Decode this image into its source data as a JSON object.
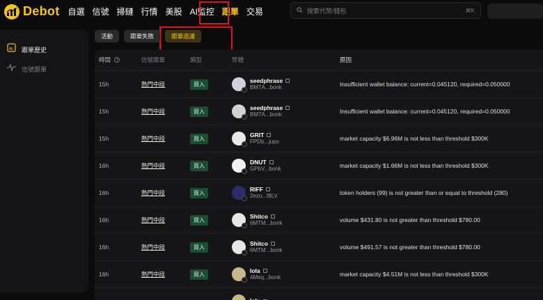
{
  "brand": {
    "name": "Debot",
    "color": "#f5c518"
  },
  "nav": {
    "items": [
      {
        "label": "自選"
      },
      {
        "label": "信號"
      },
      {
        "label": "掃鏈"
      },
      {
        "label": "行情"
      },
      {
        "label": "美股"
      },
      {
        "label": "AI監控"
      },
      {
        "label": "跟單",
        "active": true
      },
      {
        "label": "交易"
      }
    ]
  },
  "search": {
    "placeholder": "搜索代幣/錢包",
    "shortcut": "⌘K"
  },
  "sidebar": {
    "items": [
      {
        "label": "跟單歷史",
        "icon": "ai-chart-icon",
        "active": true
      },
      {
        "label": "信號跟單",
        "icon": "pulse-icon",
        "active": false
      }
    ]
  },
  "tabs": [
    {
      "label": "活動",
      "active": false
    },
    {
      "label": "跟單失敗",
      "active": false
    },
    {
      "label": "跟單過濾",
      "active": true
    }
  ],
  "table": {
    "headers": {
      "time": "時間",
      "signal": "信號跟單",
      "type": "類型",
      "coin": "幣種",
      "reason": "原因"
    },
    "rows": [
      {
        "time": "15h",
        "signal": "熱門中段",
        "type": "買入",
        "name": "seedphrase",
        "addr": "BM7A...bonk",
        "reason": "Insufficient wallet balance: current=0.045120, required=0.050000"
      },
      {
        "time": "15h",
        "signal": "熱門中段",
        "type": "買入",
        "name": "seedphrase",
        "addr": "BM7A...bonk",
        "reason": "Insufficient wallet balance: current=0.045120, required=0.050000"
      },
      {
        "time": "15h",
        "signal": "熱門中段",
        "type": "買入",
        "name": "GRIT",
        "addr": "FPDb...jups",
        "reason": "market capacity $6.96M is not less than threshold $300K"
      },
      {
        "time": "16h",
        "signal": "熱門中段",
        "type": "買入",
        "name": "DNUT",
        "addr": "GPbV...bonk",
        "reason": "market capacity $1.66M is not less than threshold $300K"
      },
      {
        "time": "16h",
        "signal": "熱門中段",
        "type": "買入",
        "name": "RIFF",
        "addr": "2ezo...f8LV",
        "reason": "token holders (99) is not greater than or equal to threshold (280)"
      },
      {
        "time": "16h",
        "signal": "熱門中段",
        "type": "買入",
        "name": "Shitco",
        "addr": "6MTM...bonk",
        "reason": "volume $431.80 is not greater than threshold $780.00"
      },
      {
        "time": "16h",
        "signal": "熱門中段",
        "type": "買入",
        "name": "Shitco",
        "addr": "6MTM...bonk",
        "reason": "volume $491.57 is not greater than threshold $780.00"
      },
      {
        "time": "16h",
        "signal": "熱門中段",
        "type": "買入",
        "name": "lola",
        "addr": "4Meq...bonk",
        "reason": "market capacity $4.51M is not less than threshold $300K"
      },
      {
        "time": "",
        "signal": "",
        "type": "",
        "name": "lola",
        "addr": "",
        "reason": ""
      }
    ]
  }
}
